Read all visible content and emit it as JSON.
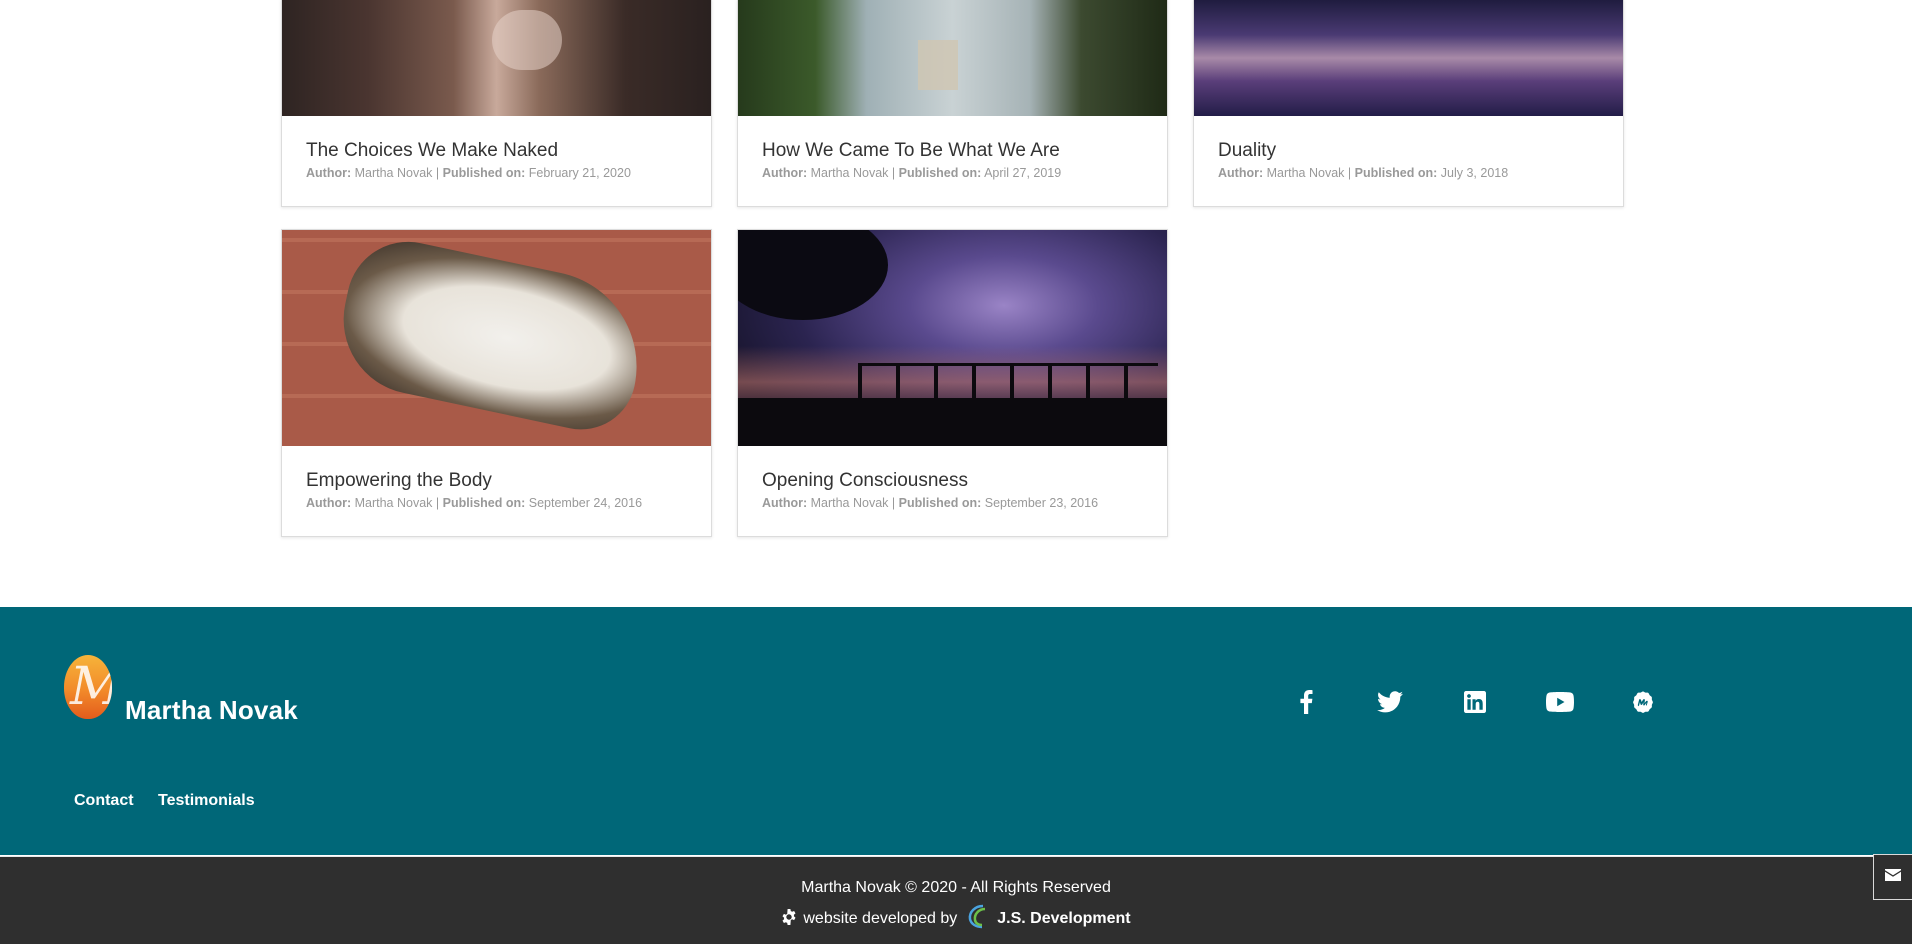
{
  "posts": [
    {
      "title": "The Choices We Make Naked",
      "author_label": "Author:",
      "author": "Martha Novak",
      "sep": "|",
      "published_label": "Published on:",
      "date": "February 21, 2020"
    },
    {
      "title": "How We Came To Be What We Are",
      "author_label": "Author:",
      "author": "Martha Novak",
      "sep": "|",
      "published_label": "Published on:",
      "date": "April 27, 2019"
    },
    {
      "title": "Duality",
      "author_label": "Author:",
      "author": "Martha Novak",
      "sep": "|",
      "published_label": "Published on:",
      "date": "July 3, 2018"
    },
    {
      "title": "Empowering the Body",
      "author_label": "Author:",
      "author": "Martha Novak",
      "sep": "|",
      "published_label": "Published on:",
      "date": "September 24, 2016"
    },
    {
      "title": "Opening Consciousness",
      "author_label": "Author:",
      "author": "Martha Novak",
      "sep": "|",
      "published_label": "Published on:",
      "date": "September 23, 2016"
    }
  ],
  "footer": {
    "brand": "Martha Novak",
    "social": [
      "facebook-icon",
      "twitter-icon",
      "linkedin-icon",
      "youtube-icon",
      "meetup-icon"
    ],
    "links": {
      "contact": "Contact",
      "testimonials": "Testimonials"
    },
    "copyright": "Martha Novak © 2020 - All Rights Reserved",
    "developed_by": "website developed by",
    "developer": "J.S. Development"
  },
  "colors": {
    "footer_bg": "#006778",
    "bottom_bg": "#2f2f2f",
    "logo_orange": "#f28a2a"
  },
  "mail_button_icon": "envelope-icon"
}
